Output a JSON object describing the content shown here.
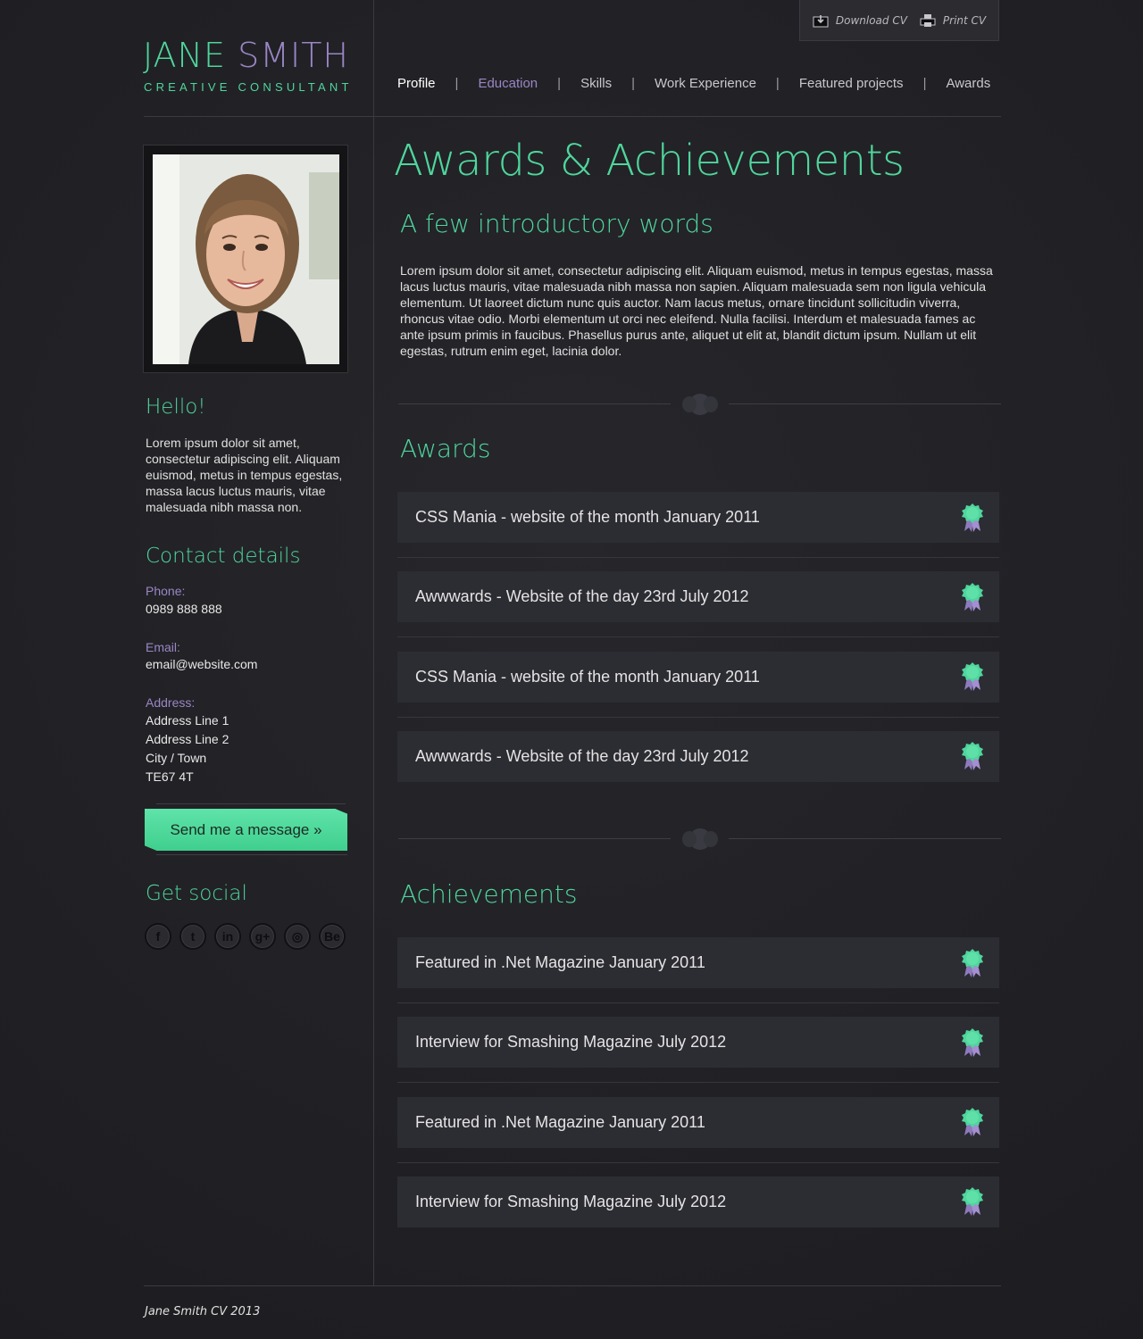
{
  "cv_actions": {
    "download_label": "Download CV",
    "download_icon": "download-icon",
    "print_label": "Print CV",
    "print_icon": "printer-icon"
  },
  "brand": {
    "first_name": "JANE",
    "last_name": "SMITH",
    "tagline": "CREATIVE CONSULTANT"
  },
  "nav": {
    "items": [
      {
        "label": "Profile",
        "state": "active"
      },
      {
        "label": "Education",
        "state": "highlighted"
      },
      {
        "label": "Skills",
        "state": "normal"
      },
      {
        "label": "Work Experience",
        "state": "normal"
      },
      {
        "label": "Featured projects",
        "state": "normal"
      },
      {
        "label": "Awards",
        "state": "normal"
      }
    ],
    "separator": "|"
  },
  "sidebar": {
    "hello_heading": "Hello!",
    "hello_text": "Lorem ipsum dolor sit amet, consectetur adipiscing elit. Aliquam euismod, metus in tempus egestas, massa lacus luctus mauris, vitae malesuada nibh massa non.",
    "contact_heading": "Contact details",
    "phone_label": "Phone:",
    "phone_value": "0989 888 888",
    "email_label": "Email:",
    "email_value": "email@website.com",
    "address_label": "Address:",
    "address_lines": [
      "Address Line 1",
      "Address Line 2",
      "City / Town",
      "TE67 4T"
    ],
    "message_button": "Send me a message »",
    "social_heading": "Get social",
    "social_icons": [
      {
        "name": "facebook-icon",
        "glyph": "f"
      },
      {
        "name": "twitter-icon",
        "glyph": "t"
      },
      {
        "name": "linkedin-icon",
        "glyph": "in"
      },
      {
        "name": "google-plus-icon",
        "glyph": "g+"
      },
      {
        "name": "dribbble-icon",
        "glyph": "◎"
      },
      {
        "name": "behance-icon",
        "glyph": "Be"
      }
    ]
  },
  "main": {
    "title": "Awards & Achievements",
    "intro_heading": "A few introductory words",
    "intro_text": "Lorem ipsum dolor sit amet, consectetur adipiscing elit. Aliquam euismod, metus in tempus egestas, massa lacus luctus mauris, vitae malesuada nibh massa non sapien. Aliquam malesuada sem non ligula vehicula elementum. Ut laoreet dictum nunc quis auctor. Nam lacus metus, ornare tincidunt sollicitudin viverra, rhoncus vitae odio. Morbi elementum ut orci nec eleifend. Nulla facilisi. Interdum et malesuada fames ac ante ipsum primis in faucibus. Phasellus purus ante, aliquet ut elit at, blandit dictum ipsum. Nullam ut elit egestas, rutrum enim eget, lacinia dolor.",
    "awards_heading": "Awards",
    "awards": [
      "CSS Mania - website of the month January 2011",
      "Awwwards - Website of the day 23rd July 2012",
      "CSS Mania - website of the month January 2011",
      "Awwwards - Website of the day 23rd July 2012"
    ],
    "achievements_heading": "Achievements",
    "achievements": [
      "Featured in .Net Magazine January 2011",
      "Interview for Smashing Magazine July 2012",
      "Featured in .Net Magazine January 2011",
      "Interview for Smashing Magazine July 2012"
    ],
    "ribbon_icon": "award-ribbon-icon"
  },
  "footer": {
    "text": "Jane Smith CV 2013"
  },
  "colors": {
    "accent_green": "#4fd69c",
    "accent_purple": "#9a86c4",
    "background": "#222226",
    "card": "#2c2c33"
  }
}
